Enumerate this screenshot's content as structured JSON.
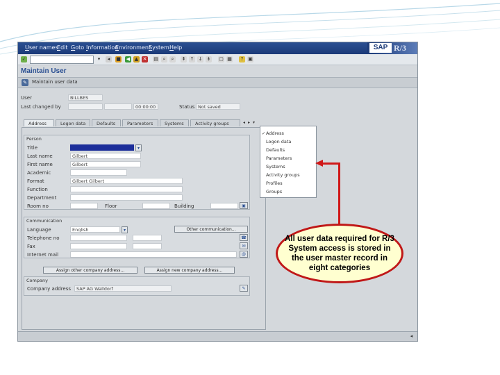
{
  "window": {
    "menu": [
      "User names",
      "Edit",
      "Goto",
      "Information",
      "Environment",
      "System",
      "Help"
    ],
    "logo": {
      "brand": "SAP",
      "product": "R/3"
    },
    "title": "Maintain User",
    "appbar_label": "Maintain user data"
  },
  "header_fields": {
    "user_label": "User",
    "user_value": "BILLBES",
    "last_changed_label": "Last changed by",
    "time_value": "00:00:00",
    "status_label": "Status",
    "status_value": "Not saved"
  },
  "tabs": [
    "Address",
    "Logon data",
    "Defaults",
    "Parameters",
    "Systems",
    "Activity groups"
  ],
  "tab_dropdown": {
    "items": [
      "Address",
      "Logon data",
      "Defaults",
      "Parameters",
      "Systems",
      "Activity groups",
      "Profiles",
      "Groups"
    ]
  },
  "person": {
    "group_title": "Person",
    "title_label": "Title",
    "last_name_label": "Last name",
    "last_name_value": "Gilbert",
    "first_name_label": "First name",
    "first_name_value": "Gilbert",
    "academic_label": "Academic",
    "format_label": "Format",
    "format_value": "Gilbert Gilbert",
    "function_label": "Function",
    "department_label": "Department",
    "room_label": "Room no",
    "floor_label": "Floor",
    "building_label": "Building"
  },
  "communication": {
    "group_title": "Communication",
    "language_label": "Language",
    "language_value": "English",
    "telephone_label": "Telephone no",
    "fax_label": "Fax",
    "internet_label": "Internet mail",
    "other_comm_button": "Other communication...",
    "assign_other_button": "Assign other company address...",
    "assign_new_button": "Assign new company address..."
  },
  "company": {
    "group_title": "Company",
    "address_label": "Company address",
    "address_value": "SAP AG Walldorf"
  },
  "callout": {
    "text": "All user data required for R/3 System access is stored in the user master record in eight categories"
  },
  "colors": {
    "menubar": "#1b3a78",
    "title": "#2a4f92",
    "callout_border": "#c01818",
    "callout_fill": "#ffffd0",
    "arrow": "#d01818"
  }
}
